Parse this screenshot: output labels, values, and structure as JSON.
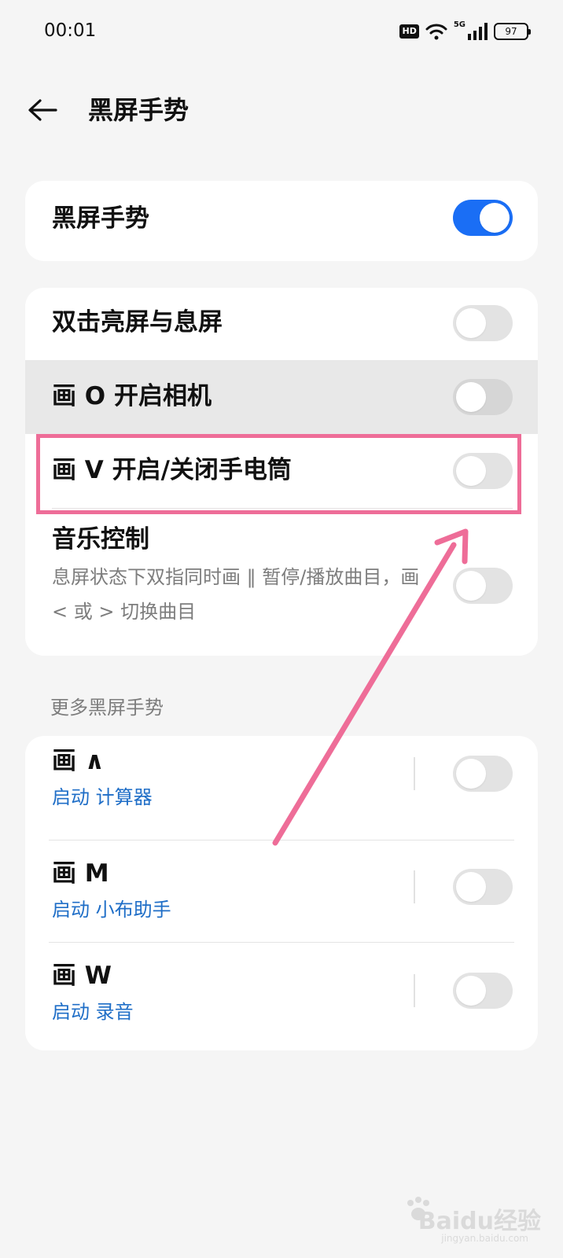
{
  "status_bar": {
    "time": "00:01",
    "hd_label": "HD",
    "network_label": "5G",
    "battery_level": "97",
    "icons": [
      "hd-icon",
      "wifi-icon",
      "signal-icon",
      "battery-icon"
    ]
  },
  "header": {
    "title": "黑屏手势",
    "back_icon": "back-arrow-icon"
  },
  "master_switch": {
    "label": "黑屏手势",
    "on": true
  },
  "gestures": [
    {
      "label": "双击亮屏与息屏",
      "on": false
    },
    {
      "label": "画 O 开启相机",
      "on": false
    },
    {
      "label": "画 V 开启/关闭手电筒",
      "on": false
    },
    {
      "label": "音乐控制",
      "description": "息屏状态下双指同时画 ‖ 暂停/播放曲目，画 < 或 > 切换曲目",
      "on": false
    }
  ],
  "more_section": {
    "header": "更多黑屏手势",
    "items": [
      {
        "title": "画 ∧",
        "action": "启动 计算器",
        "on": false
      },
      {
        "title": "画 M",
        "action": "启动 小布助手",
        "on": false
      },
      {
        "title": "画 W",
        "action": "启动 录音",
        "on": false
      }
    ]
  },
  "annotation": {
    "color": "#ee6d98",
    "highlight_target": "画 V 开启/关闭手电筒"
  },
  "watermark": {
    "text": "Baidu经验",
    "sub": "jingyan.baidu.com"
  },
  "colors": {
    "accent": "#1a6ef5",
    "action_text": "#1f6ec7",
    "background": "#f5f5f5",
    "pressed_row": "#e8e8e8"
  }
}
